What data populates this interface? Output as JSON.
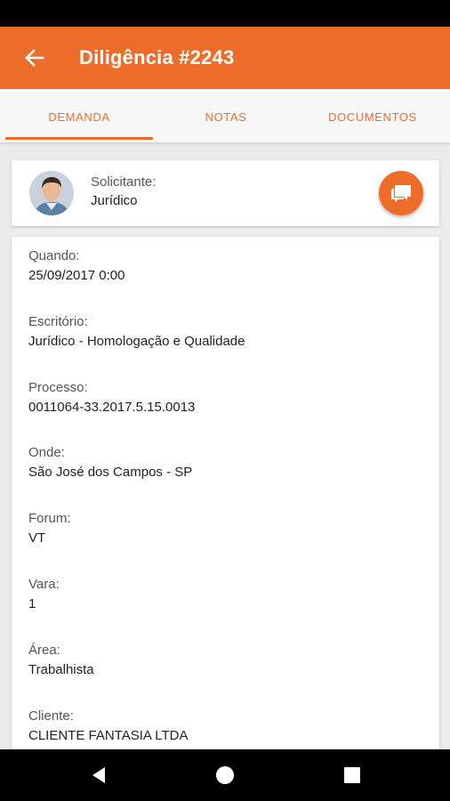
{
  "header": {
    "title": "Diligência #2243",
    "back_icon": "arrow-left-icon"
  },
  "tabs": [
    {
      "label": "DEMANDA",
      "active": true
    },
    {
      "label": "NOTAS",
      "active": false
    },
    {
      "label": "DOCUMENTOS",
      "active": false
    }
  ],
  "requester": {
    "label": "Solicitante:",
    "value": "Jurídico",
    "chat_icon": "chat-icon"
  },
  "details": [
    {
      "label": "Quando:",
      "value": "25/09/2017 0:00"
    },
    {
      "label": "Escritório:",
      "value": "Jurídico - Homologação e Qualidade"
    },
    {
      "label": "Processo:",
      "value": "0011064-33.2017.5.15.0013"
    },
    {
      "label": "Onde:",
      "value": "São José dos Campos - SP"
    },
    {
      "label": "Forum:",
      "value": "VT"
    },
    {
      "label": "Vara:",
      "value": "1"
    },
    {
      "label": "Área:",
      "value": "Trabalhista"
    },
    {
      "label": "Cliente:",
      "value": "CLIENTE FANTASIA LTDA"
    }
  ],
  "nav": {
    "back_icon": "nav-back-icon",
    "home_icon": "nav-home-icon",
    "recents_icon": "nav-recents-icon"
  },
  "colors": {
    "accent": "#ee6c2a",
    "background": "#ececec"
  }
}
